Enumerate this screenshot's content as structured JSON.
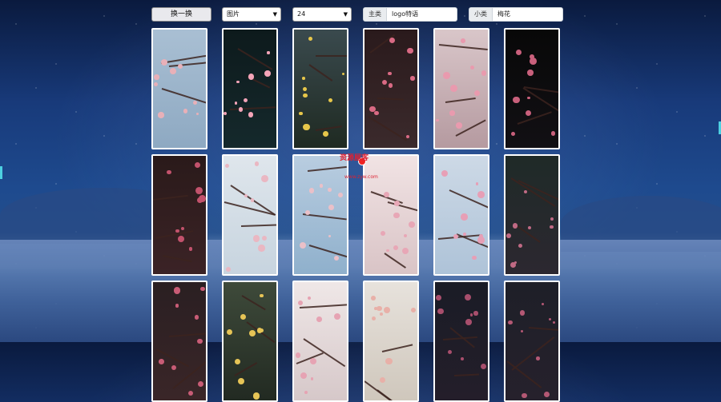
{
  "toolbar": {
    "swap_label": "换一换",
    "type_select": "图片",
    "count_select": "24",
    "category_label": "主类",
    "category_value": "logo特语",
    "subcategory_label": "小类",
    "subcategory_value": "梅花"
  },
  "colors": {
    "accent": "#e9e9ed",
    "watermark": "#dd2233"
  },
  "cards": [
    {
      "bg": "linear-gradient(180deg,#a9bfd3,#8ea9c2)",
      "flower": "#e8b0b8"
    },
    {
      "bg": "linear-gradient(180deg,#0d1a1c,#15292c)",
      "flower": "#f3a4b8"
    },
    {
      "bg": "linear-gradient(180deg,#3a4a4e,#1f2a22)",
      "flower": "#e6c64a"
    },
    {
      "bg": "linear-gradient(180deg,#2a1a1c,#3b2a2c)",
      "flower": "#d96a84"
    },
    {
      "bg": "linear-gradient(180deg,#d9c6c9,#b59aa0)",
      "flower": "#e99aae"
    },
    {
      "bg": "linear-gradient(180deg,#080808,#121014)",
      "flower": "#c9607c"
    },
    {
      "bg": "linear-gradient(180deg,#2a1a1a,#3b2326)",
      "flower": "#c2526c"
    },
    {
      "bg": "linear-gradient(180deg,#dfe6ec,#c7d4df)",
      "flower": "#eab7c2"
    },
    {
      "bg": "linear-gradient(180deg,#b9cde0,#8fb0cc)",
      "flower": "#eac0c8"
    },
    {
      "bg": "linear-gradient(180deg,#f1e3e4,#d9c4c6)",
      "flower": "#e8a7b6"
    },
    {
      "bg": "linear-gradient(180deg,#cdd9e6,#aec3d8)",
      "flower": "#e79fb6"
    },
    {
      "bg": "linear-gradient(180deg,#1f2a28,#2c2830)",
      "flower": "#c06a84"
    },
    {
      "bg": "linear-gradient(180deg,#2a1f22,#3a2628)",
      "flower": "#c85c76"
    },
    {
      "bg": "linear-gradient(180deg,#3e4a3a,#222a22)",
      "flower": "#e6c456"
    },
    {
      "bg": "linear-gradient(180deg,#efe7e7,#d6c8c9)",
      "flower": "#e6a3b3"
    },
    {
      "bg": "linear-gradient(180deg,#e7e2dc,#cfc7bc)",
      "flower": "#e8b0a8"
    },
    {
      "bg": "linear-gradient(180deg,#1a1c26,#241e2a)",
      "flower": "#a84e6c"
    },
    {
      "bg": "linear-gradient(180deg,#1e1f28,#26212c)",
      "flower": "#b45874"
    }
  ],
  "watermark": {
    "text": "资源屋客",
    "sub": "www.zyw.com"
  }
}
